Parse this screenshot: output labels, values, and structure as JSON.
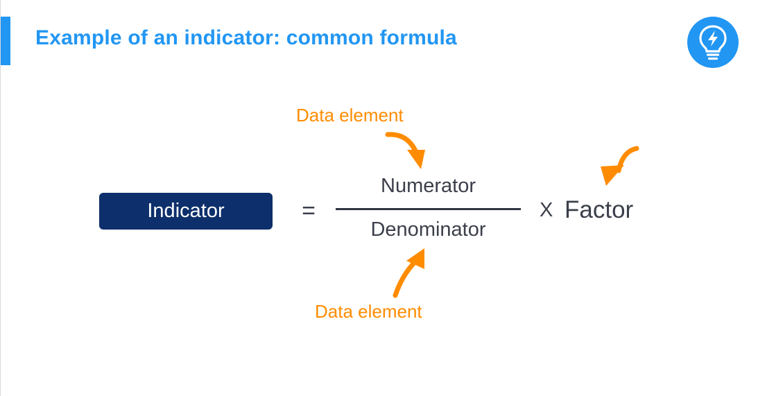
{
  "slide": {
    "title": "Example of an indicator: common formula",
    "accent_color": "#2196f3",
    "badge_icon": "lightbulb-lightning-icon"
  },
  "formula": {
    "indicator_label": "Indicator",
    "equals_sign": "=",
    "numerator": "Numerator",
    "denominator": "Denominator",
    "multiply_sign": "X",
    "factor": "Factor",
    "indicator_box_color": "#0d2f6b",
    "text_color": "#3b3f4a"
  },
  "annotations": {
    "top_label": "Data element",
    "bottom_label": "Data element",
    "color": "#ff8c00",
    "arrow_icon": "curved-arrow-icon"
  }
}
